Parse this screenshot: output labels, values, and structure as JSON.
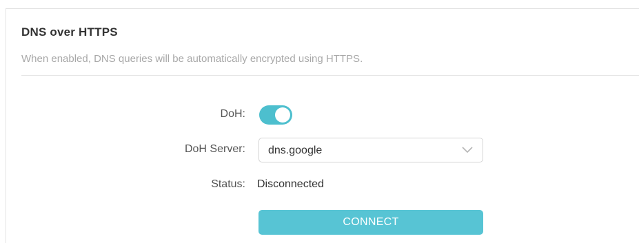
{
  "section": {
    "title": "DNS over HTTPS",
    "description": "When enabled, DNS queries will be automatically encrypted using HTTPS."
  },
  "doh": {
    "label": "DoH:",
    "enabled": true
  },
  "server": {
    "label": "DoH Server:",
    "value": "dns.google",
    "icon": "chevron-down-icon"
  },
  "status": {
    "label": "Status:",
    "value": "Disconnected"
  },
  "connect_button": {
    "label": "CONNECT"
  },
  "colors": {
    "accent": "#4dbfce",
    "button": "#57c4d4"
  }
}
